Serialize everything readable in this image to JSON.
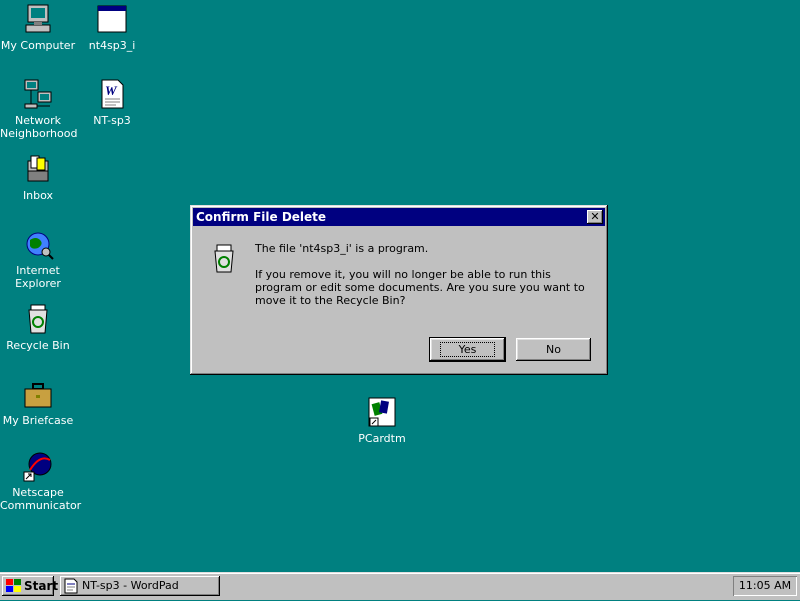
{
  "desktop": {
    "background": "#008080",
    "icons": [
      {
        "label": "My Computer",
        "icon": "my-computer-icon"
      },
      {
        "label": "nt4sp3_i",
        "icon": "program-window-icon"
      },
      {
        "label": "Network Neighborhood",
        "icon": "network-neighborhood-icon"
      },
      {
        "label": "NT-sp3",
        "icon": "wordpad-document-icon"
      },
      {
        "label": "Inbox",
        "icon": "inbox-icon"
      },
      {
        "label": "Internet Explorer",
        "icon": "internet-explorer-icon"
      },
      {
        "label": "Recycle Bin",
        "icon": "recycle-bin-icon"
      },
      {
        "label": "My Briefcase",
        "icon": "briefcase-icon"
      },
      {
        "label": "Netscape Communicator",
        "icon": "netscape-icon"
      },
      {
        "label": "PCardtm",
        "icon": "pcard-shortcut-icon"
      }
    ]
  },
  "dialog": {
    "title": "Confirm File Delete",
    "close_label": "✕",
    "icon": "recycle-bin-icon",
    "message_line1": "The file 'nt4sp3_i' is a program.",
    "message_line2": "If you remove it, you will no longer be able to run this program or edit some documents. Are you sure you want to move it to the Recycle Bin?",
    "yes_label": "Yes",
    "no_label": "No"
  },
  "taskbar": {
    "start_label": "Start",
    "task_label": "NT-sp3 - WordPad",
    "clock": "11:05 AM"
  },
  "colors": {
    "titlebar": "#000080",
    "face": "#c0c0c0"
  }
}
